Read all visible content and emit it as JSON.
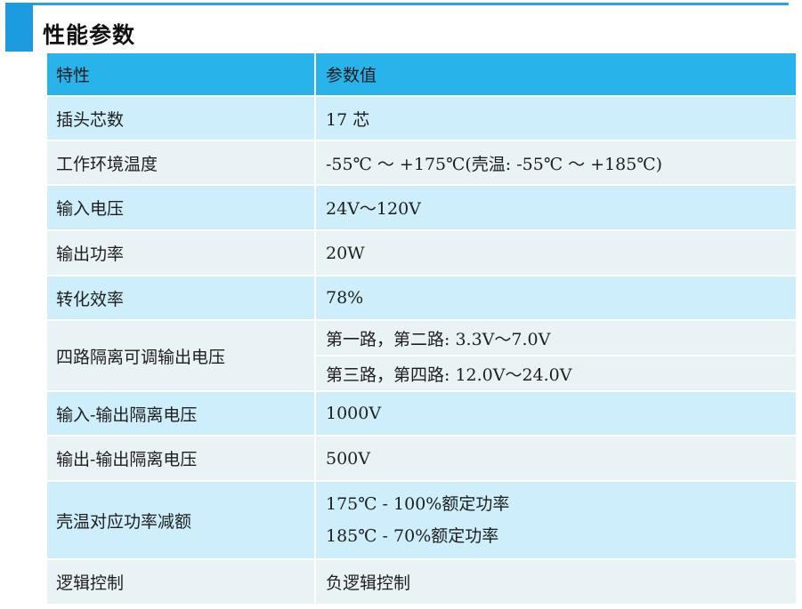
{
  "section": {
    "title": "性能参数"
  },
  "table": {
    "headers": [
      "特性",
      "参数值"
    ],
    "rows": [
      {
        "key": "插头芯数",
        "value": "17 芯"
      },
      {
        "key": "工作环境温度",
        "value": "-55℃ ～ +175℃(壳温: -55℃ ～ +185℃)"
      },
      {
        "key": "输入电压",
        "value": "24V～120V"
      },
      {
        "key": "输出功率",
        "value": "20W"
      },
      {
        "key": "转化效率",
        "value": "78%"
      },
      {
        "key": "四路隔离可调输出电压",
        "value_lines": [
          "第一路，第二路: 3.3V～7.0V",
          "第三路，第四路: 12.0V～24.0V"
        ]
      },
      {
        "key": "输入-输出隔离电压",
        "value": "1000V"
      },
      {
        "key": "输出-输出隔离电压",
        "value": "500V"
      },
      {
        "key": "壳温对应功率减额",
        "value_lines": [
          "175℃ - 100%额定功率",
          "185℃ - 70%额定功率"
        ]
      },
      {
        "key": "逻辑控制",
        "value": "负逻辑控制"
      }
    ]
  },
  "colors": {
    "header": "#28b4ea",
    "row_light": "#cdeefa",
    "row_alt": "#e9f3f6",
    "accent": "#1d9be0"
  }
}
